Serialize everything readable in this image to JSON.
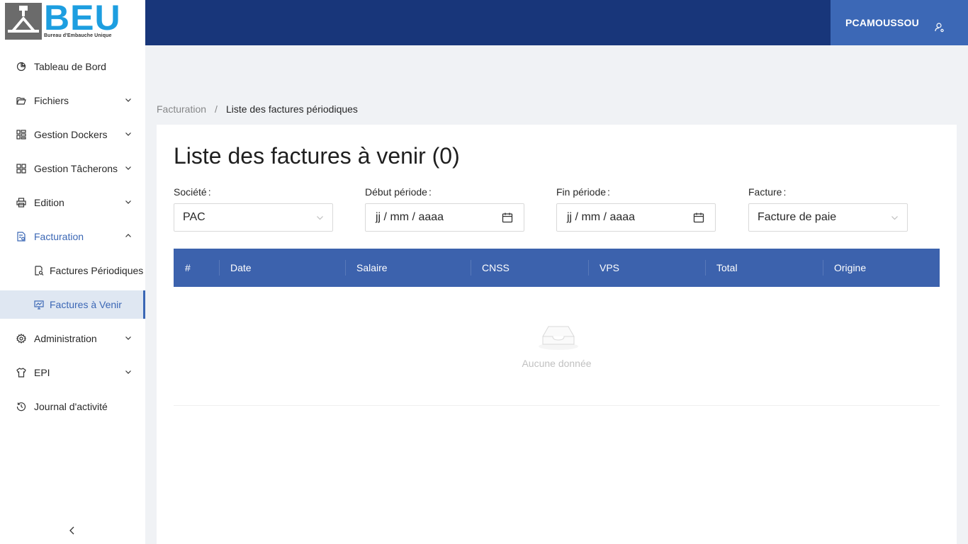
{
  "logo": {
    "big": "BEU",
    "small": "Bureau d'Embauche Unique"
  },
  "header": {
    "username": "PCAMOUSSOU"
  },
  "sidebar": {
    "items": [
      {
        "label": "Tableau de Bord",
        "icon": "pie-chart-icon"
      },
      {
        "label": "Fichiers",
        "icon": "folder-open-icon"
      },
      {
        "label": "Gestion Dockers",
        "icon": "appstore-icon"
      },
      {
        "label": "Gestion Tâcherons",
        "icon": "build-icon"
      },
      {
        "label": "Edition",
        "icon": "printer-icon"
      },
      {
        "label": "Facturation",
        "icon": "file-icon"
      },
      {
        "label": "Administration",
        "icon": "setting-icon"
      },
      {
        "label": "EPI",
        "icon": "shirt-icon"
      },
      {
        "label": "Journal d'activité",
        "icon": "history-icon"
      }
    ],
    "facturation_sub": [
      {
        "label": "Factures Périodiques",
        "icon": "file-search-icon"
      },
      {
        "label": "Factures à Venir",
        "icon": "fund-projection-icon"
      }
    ]
  },
  "breadcrumb": {
    "parent": "Facturation",
    "separator": "/",
    "current": "Liste des factures périodiques"
  },
  "page": {
    "title": "Liste des factures à venir (0)",
    "filters": {
      "societe_label": "Société",
      "societe_value": "PAC",
      "debut_label": "Début période",
      "debut_value": "jj / mm / aaaa",
      "fin_label": "Fin période",
      "fin_value": "jj / mm / aaaa",
      "facture_label": "Facture",
      "facture_value": "Facture de paie",
      "colon": ":"
    },
    "table": {
      "columns": [
        "#",
        "Date",
        "Salaire",
        "CNSS",
        "VPS",
        "Total",
        "Origine"
      ],
      "rows": [],
      "empty_text": "Aucune donnée"
    }
  },
  "colors": {
    "header": "#18367a",
    "user_block": "#3c68b6",
    "table_head": "#3c62ad",
    "accent": "#3b67b5"
  }
}
